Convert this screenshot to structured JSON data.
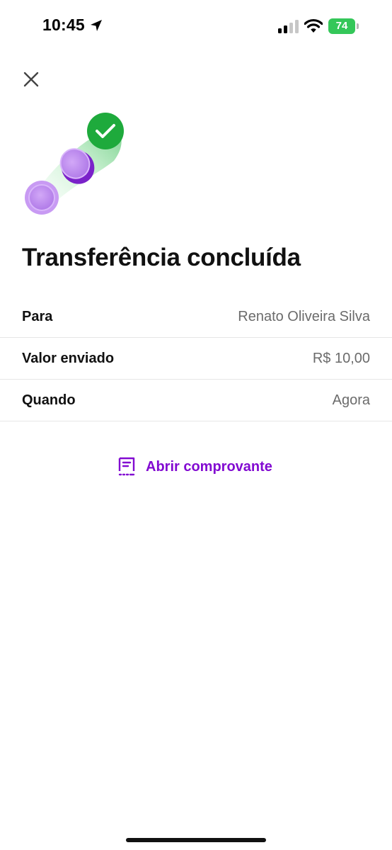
{
  "status_bar": {
    "time": "10:45",
    "battery_level": "74",
    "icons": [
      "location-arrow-icon",
      "signal-icon",
      "wifi-icon",
      "battery-icon"
    ]
  },
  "header": {
    "close_icon": "close-icon"
  },
  "illustration": {
    "icons": [
      "coin-icon",
      "check-circle-icon"
    ],
    "colors": {
      "coin": "#b77cf0",
      "check": "#1eaa3c",
      "trail": "#bfeec8"
    }
  },
  "title": "Transferência concluída",
  "details": [
    {
      "label": "Para",
      "value": "Renato Oliveira Silva"
    },
    {
      "label": "Valor enviado",
      "value": "R$ 10,00"
    },
    {
      "label": "Quando",
      "value": "Agora"
    }
  ],
  "receipt": {
    "label": "Abrir comprovante",
    "icon": "receipt-icon",
    "color": "#820ad1"
  },
  "colors": {
    "accent": "#820ad1",
    "battery": "#34c759",
    "text": "#111111",
    "muted": "#6b6b6b"
  }
}
